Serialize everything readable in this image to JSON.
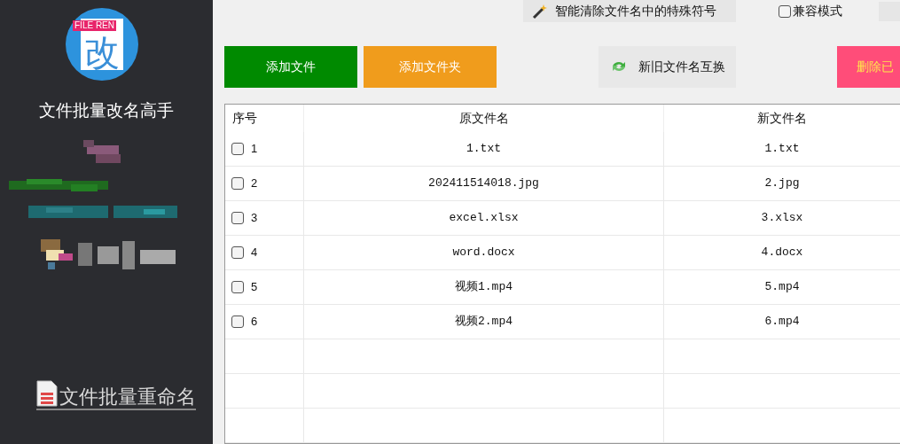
{
  "sidebar": {
    "logo_badge": "FILE REN",
    "logo_char": "改",
    "app_title": "文件批量改名高手",
    "footer_link": "文件批量重命名"
  },
  "toolbar": {
    "clean_button": "智能清除文件名中的特殊符号",
    "compat_mode": {
      "label": "兼容模式",
      "checked": false
    }
  },
  "actions": [
    {
      "kind": "add",
      "label": "添加文件"
    },
    {
      "kind": "add_folder",
      "label": "添加文件夹"
    },
    {
      "kind": "swap",
      "label": "新旧文件名互换"
    },
    {
      "kind": "delete",
      "label": "删除已"
    }
  ],
  "table": {
    "columns": [
      "序号",
      "原文件名",
      "新文件名"
    ],
    "rows": [
      {
        "index": "1",
        "checked": false,
        "original": "1.txt",
        "new": "1.txt"
      },
      {
        "index": "2",
        "checked": false,
        "original": "202411514018.jpg",
        "new": "2.jpg"
      },
      {
        "index": "3",
        "checked": false,
        "original": "excel.xlsx",
        "new": "3.xlsx"
      },
      {
        "index": "4",
        "checked": false,
        "original": "word.docx",
        "new": "4.docx"
      },
      {
        "index": "5",
        "checked": false,
        "original": "视频1.mp4",
        "new": "5.mp4"
      },
      {
        "index": "6",
        "checked": false,
        "original": "视频2.mp4",
        "new": "6.mp4"
      }
    ]
  }
}
